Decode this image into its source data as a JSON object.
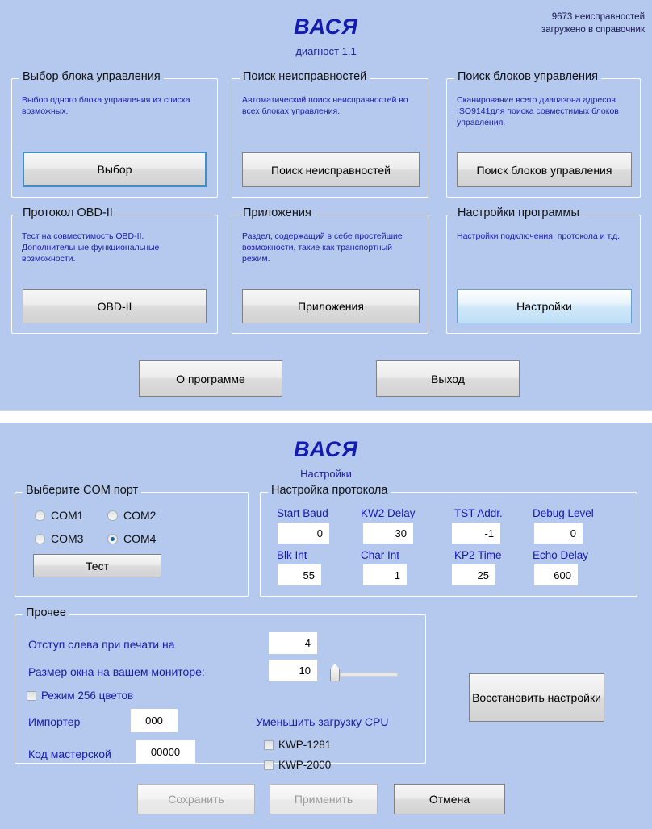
{
  "main_window": {
    "title": "ВАСЯ",
    "subtitle": "диагност 1.1",
    "corner_note_line1": "9673 неисправностей",
    "corner_note_line2": "загружено в справочник",
    "panels": [
      {
        "legend": "Выбор блока управления",
        "description": "Выбор одного блока управления из списка возможных.",
        "button": "Выбор"
      },
      {
        "legend": "Поиск неисправностей",
        "description": "Автоматический поиск неисправностей во всех блоках управления.",
        "button": "Поиск неисправностей"
      },
      {
        "legend": "Поиск блоков управления",
        "description": "Сканирование всего диапазона адресов ISO9141для поиска совместимых блоков управления.",
        "button": "Поиск блоков управления"
      },
      {
        "legend": "Протокол OBD-II",
        "description": "Тест на совместимость OBD-II. Дополнительные функциональные возможности.",
        "button": "OBD-II"
      },
      {
        "legend": "Приложения",
        "description": "Раздел, содержащий в себе простейшие возможности, такие как транспортный режим.",
        "button": "Приложения"
      },
      {
        "legend": "Настройки программы",
        "description": "Настройки подключения, протокола и т.д.",
        "button": "Настройки"
      }
    ],
    "about_button": "О программе",
    "exit_button": "Выход"
  },
  "settings_window": {
    "title": "ВАСЯ",
    "subtitle": "Настройки",
    "com_group": {
      "legend": "Выберите COM порт",
      "options": [
        {
          "label": "COM1",
          "selected": false
        },
        {
          "label": "COM2",
          "selected": false
        },
        {
          "label": "COM3",
          "selected": false
        },
        {
          "label": "COM4",
          "selected": true
        }
      ],
      "test_button": "Тест"
    },
    "protocol_group": {
      "legend": "Настройка протокола",
      "fields": [
        {
          "label": "Start Baud",
          "value": "0"
        },
        {
          "label": "KW2 Delay",
          "value": "30"
        },
        {
          "label": "TST Addr.",
          "value": "-1"
        },
        {
          "label": "Debug Level",
          "value": "0"
        },
        {
          "label": "Blk Int",
          "value": "55"
        },
        {
          "label": "Char Int",
          "value": "1"
        },
        {
          "label": "KP2 Time",
          "value": "25"
        },
        {
          "label": "Echo Delay",
          "value": "600"
        }
      ]
    },
    "other_group": {
      "legend": "Прочее",
      "print_offset_label": "Отступ слева при печати на",
      "print_offset_value": "4",
      "window_size_label": "Размер окна на вашем мониторе:",
      "window_size_value": "10",
      "color_mode_label": "Режим 256 цветов",
      "color_mode_checked": false,
      "importer_label": "Импортер",
      "importer_value": "000",
      "workshop_label": "Код мастерской",
      "workshop_value": "00000",
      "cpu_label": "Уменьшить загрузку CPU",
      "cpu_options": [
        {
          "label": "KWP-1281",
          "checked": false
        },
        {
          "label": "KWP-2000",
          "checked": false
        }
      ]
    },
    "restore_button": "Восстановить настройки",
    "save_button": "Сохранить",
    "apply_button": "Применить",
    "cancel_button": "Отмена"
  },
  "colors": {
    "background": "#b5c8ee",
    "title": "#131bb0",
    "desc_text": "#1c1ca8",
    "focus_border": "#3d8fc6",
    "radio_dot": "#15619e"
  }
}
